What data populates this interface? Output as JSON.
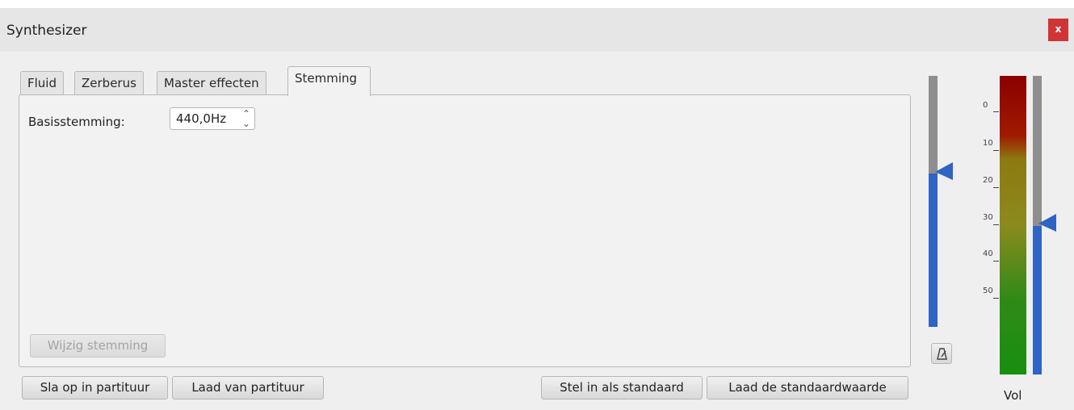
{
  "window": {
    "title": "Synthesizer",
    "close_label": "x"
  },
  "tabs": [
    {
      "label": "Fluid"
    },
    {
      "label": "Zerberus"
    },
    {
      "label": "Master effecten"
    },
    {
      "label": "Stemming",
      "active": true
    }
  ],
  "tuning": {
    "label": "Basisstemming:",
    "value": "440,0Hz",
    "change_button": "Wijzig stemming"
  },
  "footer": {
    "save_to_score": "Sla op in partituur",
    "load_from_score": "Laad van partituur",
    "set_as_default": "Stel in als standaard",
    "load_default": "Laad de standaardwaarde"
  },
  "meter": {
    "ticks": [
      "0",
      "10",
      "20",
      "30",
      "40",
      "50"
    ],
    "volume_label": "Vol",
    "colors": {
      "fader": "#2f63c4",
      "track": "#8e8e8e",
      "peak": "#8b0000",
      "low": "#178f0f"
    }
  },
  "icons": {
    "metronome": "metronome-icon",
    "close": "close-icon",
    "spin": "updown-arrows-icon"
  }
}
